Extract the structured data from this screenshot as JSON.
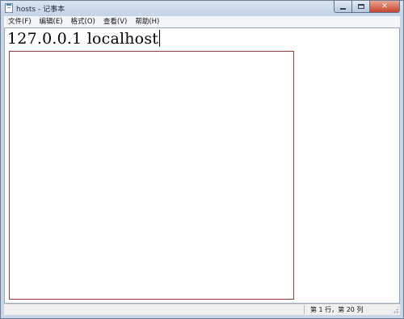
{
  "window": {
    "title": "hosts - 记事本",
    "caption_buttons": {
      "minimize_icon": "minimize-icon",
      "maximize_icon": "maximize-icon",
      "close_icon": "close-icon",
      "close_glyph": "✕"
    }
  },
  "menubar": {
    "items": [
      {
        "label": "文件(F)"
      },
      {
        "label": "编辑(E)"
      },
      {
        "label": "格式(O)"
      },
      {
        "label": "查看(V)"
      },
      {
        "label": "帮助(H)"
      }
    ]
  },
  "editor": {
    "content": "127.0.0.1 localhost"
  },
  "statusbar": {
    "position": "第 1 行，第 20 列"
  },
  "colors": {
    "title_bar": "#c9d6e6",
    "highlight_rect": "#9b3a3a",
    "close_button": "#c7452c"
  }
}
